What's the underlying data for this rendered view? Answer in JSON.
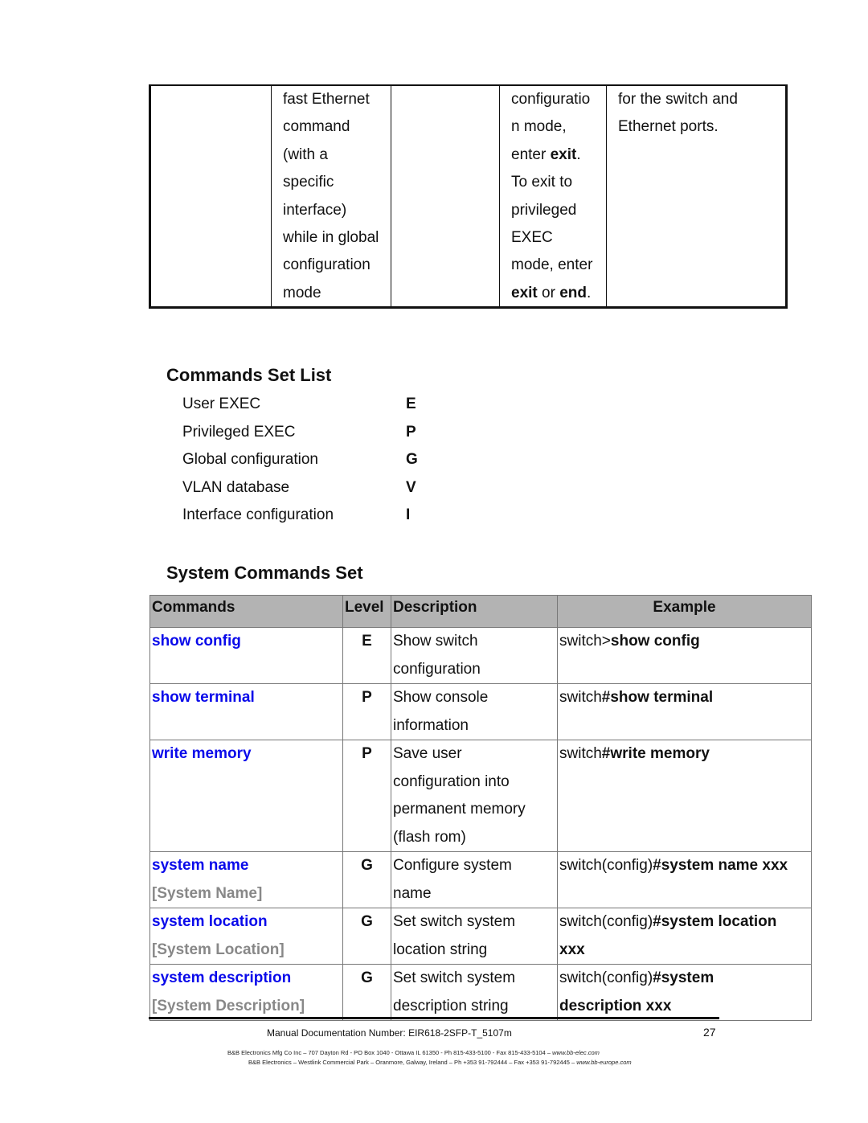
{
  "top_table": {
    "columns": [
      {
        "lines": []
      },
      {
        "lines": [
          [
            {
              "t": "fast Ethernet"
            }
          ],
          [
            {
              "t": "command"
            }
          ],
          [
            {
              "t": "(with a"
            }
          ],
          [
            {
              "t": "specific"
            }
          ],
          [
            {
              "t": "interface)"
            }
          ],
          [
            {
              "t": "while in global"
            }
          ],
          [
            {
              "t": "configuration"
            }
          ],
          [
            {
              "t": "mode"
            }
          ]
        ]
      },
      {
        "lines": []
      },
      {
        "lines": [
          [
            {
              "t": "configuratio"
            }
          ],
          [
            {
              "t": "n mode,"
            }
          ],
          [
            {
              "t": "enter "
            },
            {
              "t": "exit",
              "b": true
            },
            {
              "t": "."
            }
          ],
          [
            {
              "t": "To exit to"
            }
          ],
          [
            {
              "t": "privileged"
            }
          ],
          [
            {
              "t": "EXEC"
            }
          ],
          [
            {
              "t": "mode, enter"
            }
          ],
          [
            {
              "t": "exit",
              "b": true
            },
            {
              "t": " or "
            },
            {
              "t": "end",
              "b": true
            },
            {
              "t": "."
            }
          ]
        ]
      },
      {
        "lines": [
          [
            {
              "t": "for the switch and"
            }
          ],
          [
            {
              "t": "Ethernet ports."
            }
          ]
        ]
      }
    ]
  },
  "commands_set_list": {
    "title": "Commands Set List",
    "modes": [
      {
        "name": "User EXEC",
        "code": "E"
      },
      {
        "name": "Privileged EXEC",
        "code": "P"
      },
      {
        "name": "Global configuration",
        "code": "G"
      },
      {
        "name": "VLAN database",
        "code": "V"
      },
      {
        "name": "Interface configuration",
        "code": "I"
      }
    ]
  },
  "system_commands_set": {
    "title": "System Commands Set",
    "headers": {
      "commands": "Commands",
      "level": "Level",
      "description": "Description",
      "example": "Example"
    },
    "rows": [
      {
        "command": "show config",
        "alias": "",
        "level": "E",
        "description": [
          "Show switch",
          "configuration"
        ],
        "example": [
          [
            {
              "t": "switch>"
            },
            {
              "t": "show config",
              "b": true
            }
          ]
        ]
      },
      {
        "command": "show terminal",
        "alias": "",
        "level": "P",
        "description": [
          "Show console",
          "information"
        ],
        "example": [
          [
            {
              "t": "switch"
            },
            {
              "t": "#show terminal",
              "b": true
            }
          ]
        ]
      },
      {
        "command": "write memory",
        "alias": "",
        "level": "P",
        "description": [
          "Save user",
          "configuration into",
          "permanent memory",
          "(flash rom)"
        ],
        "example": [
          [
            {
              "t": "switch"
            },
            {
              "t": "#write memory",
              "b": true
            }
          ]
        ]
      },
      {
        "command": "system name",
        "alias": "[System Name]",
        "level": "G",
        "description": [
          "Configure system",
          "name"
        ],
        "example": [
          [
            {
              "t": "switch(config)"
            },
            {
              "t": "#system name xxx",
              "b": true
            }
          ]
        ]
      },
      {
        "command": "system location",
        "alias": "[System Location]",
        "level": "G",
        "description": [
          "Set switch system",
          "location string"
        ],
        "example": [
          [
            {
              "t": "switch(config)"
            },
            {
              "t": "#system location",
              "b": true
            }
          ],
          [
            {
              "t": "xxx",
              "b": true
            }
          ]
        ]
      },
      {
        "command": "system description",
        "alias": "[System Description]",
        "level": "G",
        "description": [
          "Set switch system",
          "description string"
        ],
        "example": [
          [
            {
              "t": "switch(config)"
            },
            {
              "t": "#system",
              "b": true
            }
          ],
          [
            {
              "t": "description xxx",
              "b": true
            }
          ]
        ]
      }
    ]
  },
  "footer": {
    "doc_number": "Manual Documentation Number: EIR618-2SFP-T_5107m",
    "page_number": "27",
    "address_us": "B&B Electronics Mfg Co Inc – 707 Dayton Rd - PO Box 1040 - Ottawa IL 61350 - Ph 815-433-5100 - Fax 815-433-5104 – ",
    "web_us": "www.bb-elec.com",
    "address_eu": "B&B Electronics – Westlink Commercial Park – Oranmore, Galway, Ireland – Ph +353 91-792444 – Fax +353 91-792445 – ",
    "web_eu": "www.bb-europe.com"
  },
  "colors": {
    "command_link": "#0a0aea",
    "alias_gray": "#888888",
    "header_fill": "#b3b3b3"
  }
}
